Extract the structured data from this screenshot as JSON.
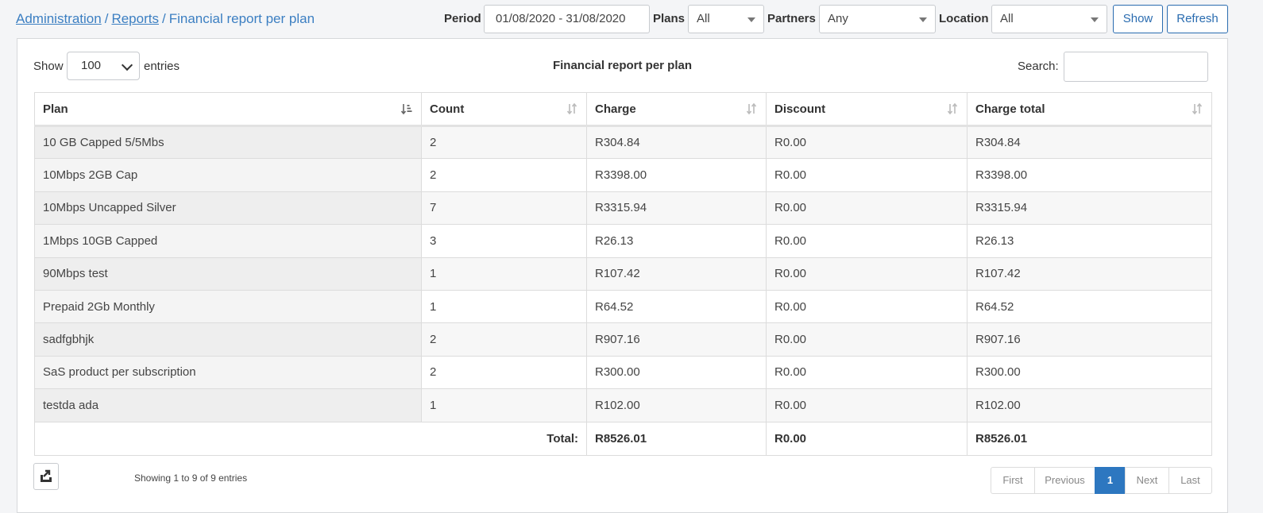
{
  "breadcrumb": {
    "items": [
      "Administration",
      "Reports"
    ],
    "current": "Financial report per plan"
  },
  "filters": {
    "period_label": "Period",
    "period_value": "01/08/2020 - 31/08/2020",
    "plans_label": "Plans",
    "plans_value": "All",
    "partners_label": "Partners",
    "partners_value": "Any",
    "location_label": "Location",
    "location_value": "All",
    "show_button": "Show",
    "refresh_button": "Refresh"
  },
  "table_controls": {
    "show_label": "Show",
    "page_length": "100",
    "entries_label": "entries",
    "title": "Financial report per plan",
    "search_label": "Search:",
    "search_value": ""
  },
  "table": {
    "columns": [
      "Plan",
      "Count",
      "Charge",
      "Discount",
      "Charge total"
    ],
    "rows": [
      [
        "10 GB Capped 5/5Mbs",
        "2",
        "R304.84",
        "R0.00",
        "R304.84"
      ],
      [
        "10Mbps 2GB Cap",
        "2",
        "R3398.00",
        "R0.00",
        "R3398.00"
      ],
      [
        "10Mbps Uncapped Silver",
        "7",
        "R3315.94",
        "R0.00",
        "R3315.94"
      ],
      [
        "1Mbps 10GB Capped",
        "3",
        "R26.13",
        "R0.00",
        "R26.13"
      ],
      [
        "90Mbps test",
        "1",
        "R107.42",
        "R0.00",
        "R107.42"
      ],
      [
        "Prepaid 2Gb Monthly",
        "1",
        "R64.52",
        "R0.00",
        "R64.52"
      ],
      [
        "sadfgbhjk",
        "2",
        "R907.16",
        "R0.00",
        "R907.16"
      ],
      [
        "SaS product per subscription",
        "2",
        "R300.00",
        "R0.00",
        "R300.00"
      ],
      [
        "testda ada",
        "1",
        "R102.00",
        "R0.00",
        "R102.00"
      ]
    ],
    "footer": {
      "label": "Total:",
      "charge": "R8526.01",
      "discount": "R0.00",
      "charge_total": "R8526.01"
    }
  },
  "footer": {
    "info": "Showing 1 to 9 of 9 entries",
    "export_icon": "export-icon"
  },
  "pagination": {
    "first": "First",
    "previous": "Previous",
    "current": "1",
    "next": "Next",
    "last": "Last"
  },
  "colors": {
    "link": "#3c7fc2",
    "button": "#2a6cb0",
    "active_page": "#2d77c0"
  }
}
